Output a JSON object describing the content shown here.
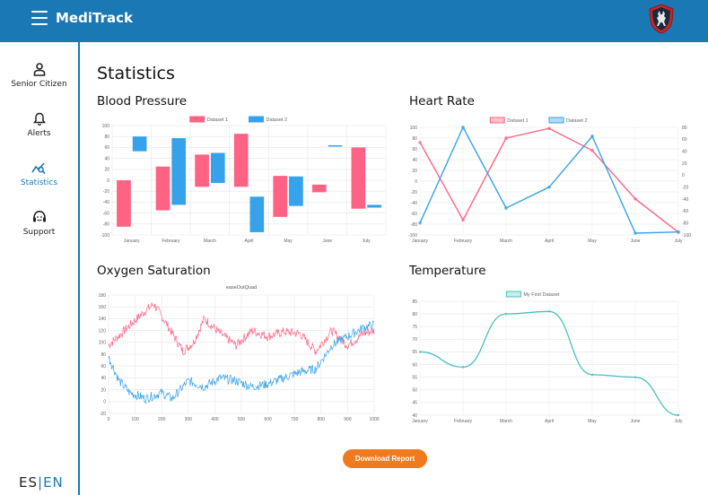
{
  "app": {
    "title": "MediTrack"
  },
  "sidebar": {
    "items": [
      {
        "label": "Senior Citizen",
        "icon": "person-icon"
      },
      {
        "label": "Alerts",
        "icon": "bell-icon"
      },
      {
        "label": "Statistics",
        "icon": "chart-search-icon",
        "active": true
      },
      {
        "label": "Support",
        "icon": "headset-icon"
      }
    ],
    "language": {
      "es": "ES",
      "sep": "|",
      "en": "EN",
      "active": "EN"
    }
  },
  "page": {
    "title": "Statistics"
  },
  "panels": {
    "blood_pressure": "Blood Pressure",
    "heart_rate": "Heart Rate",
    "oxygen": "Oxygen Saturation",
    "temperature": "Temperature"
  },
  "actions": {
    "download_label": "Download Report"
  },
  "colors": {
    "primary": "#1a78b4",
    "accent": "#f07a1e",
    "red": "#ff6384",
    "blue": "#36a2eb",
    "teal": "#4bc0c0"
  },
  "chart_data": [
    {
      "id": "blood_pressure",
      "type": "bar",
      "categories": [
        "January",
        "February",
        "March",
        "April",
        "May",
        "June",
        "July"
      ],
      "series": [
        {
          "name": "Dataset 1",
          "ranges": [
            [
              -85,
              0
            ],
            [
              -55,
              25
            ],
            [
              -12,
              47
            ],
            [
              -12,
              85
            ],
            [
              -67,
              8
            ],
            [
              -22,
              -8
            ],
            [
              -52,
              60
            ]
          ]
        },
        {
          "name": "Dataset 2",
          "ranges": [
            [
              53,
              80
            ],
            [
              -45,
              77
            ],
            [
              -5,
              50
            ],
            [
              -95,
              -30
            ],
            [
              -47,
              7
            ],
            [
              63,
              64
            ],
            [
              -50,
              -45
            ]
          ]
        }
      ],
      "ylim": [
        -100,
        100
      ],
      "yticks": [
        -100,
        -80,
        -60,
        -40,
        -20,
        0,
        20,
        40,
        60,
        80,
        100
      ],
      "legend": "top"
    },
    {
      "id": "heart_rate",
      "type": "line",
      "categories": [
        "January",
        "February",
        "March",
        "April",
        "May",
        "June",
        "July"
      ],
      "series": [
        {
          "name": "Dataset 1",
          "axis": "left",
          "values": [
            72,
            -72,
            80,
            98,
            57,
            -33,
            -95
          ]
        },
        {
          "name": "Dataset 2",
          "axis": "right",
          "values": [
            -80,
            80,
            -55,
            -20,
            65,
            -97,
            -95
          ]
        }
      ],
      "ylim_left": [
        -100,
        100
      ],
      "yticks_left": [
        -100,
        -80,
        -60,
        -40,
        -20,
        0,
        20,
        40,
        60,
        80,
        100
      ],
      "ylim_right": [
        -100,
        80
      ],
      "yticks_right": [
        -100,
        -80,
        -60,
        -40,
        -20,
        0,
        20,
        40,
        60,
        80
      ],
      "legend": "top"
    },
    {
      "id": "oxygen",
      "type": "line",
      "title": "easeOutQuad",
      "x_range": [
        0,
        1000
      ],
      "xticks": [
        0,
        100,
        200,
        300,
        400,
        500,
        600,
        700,
        800,
        900,
        1000
      ],
      "ylim": [
        -20,
        180
      ],
      "yticks": [
        -20,
        0,
        20,
        40,
        60,
        80,
        100,
        120,
        140,
        160,
        180
      ],
      "series": [
        {
          "color": "red",
          "anchors": [
            [
              0,
              95
            ],
            [
              60,
              120
            ],
            [
              130,
              150
            ],
            [
              170,
              165
            ],
            [
              220,
              130
            ],
            [
              280,
              85
            ],
            [
              320,
              100
            ],
            [
              360,
              140
            ],
            [
              420,
              115
            ],
            [
              480,
              95
            ],
            [
              540,
              120
            ],
            [
              600,
              110
            ],
            [
              660,
              118
            ],
            [
              720,
              115
            ],
            [
              780,
              85
            ],
            [
              840,
              120
            ],
            [
              900,
              95
            ],
            [
              960,
              115
            ],
            [
              1000,
              120
            ]
          ]
        },
        {
          "color": "blue",
          "anchors": [
            [
              0,
              75
            ],
            [
              40,
              35
            ],
            [
              80,
              15
            ],
            [
              140,
              5
            ],
            [
              200,
              15
            ],
            [
              240,
              5
            ],
            [
              300,
              35
            ],
            [
              360,
              25
            ],
            [
              420,
              40
            ],
            [
              480,
              35
            ],
            [
              540,
              25
            ],
            [
              600,
              30
            ],
            [
              660,
              40
            ],
            [
              720,
              50
            ],
            [
              780,
              55
            ],
            [
              840,
              95
            ],
            [
              900,
              110
            ],
            [
              960,
              125
            ],
            [
              1000,
              130
            ]
          ]
        }
      ]
    },
    {
      "id": "temperature",
      "type": "line",
      "categories": [
        "January",
        "February",
        "March",
        "April",
        "May",
        "June",
        "July"
      ],
      "series": [
        {
          "name": "My First Dataset",
          "values": [
            65,
            59,
            80,
            81,
            56,
            55,
            40
          ]
        }
      ],
      "ylim": [
        40,
        85
      ],
      "yticks": [
        40,
        45,
        50,
        55,
        60,
        65,
        70,
        75,
        80,
        85
      ],
      "legend": "top"
    }
  ]
}
